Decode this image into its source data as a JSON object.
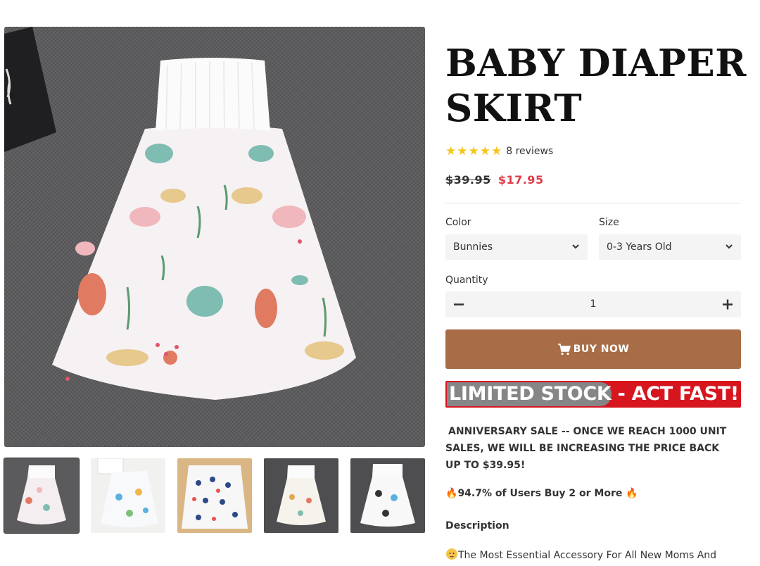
{
  "product": {
    "title": "BABY DIAPER SKIRT",
    "rating": {
      "stars": 5,
      "reviews_label": "8 reviews"
    },
    "price": {
      "compare_at": "$39.95",
      "sale": "$17.95"
    }
  },
  "options": {
    "color": {
      "label": "Color",
      "selected": "Bunnies"
    },
    "size": {
      "label": "Size",
      "selected": "0-3 Years Old"
    }
  },
  "quantity": {
    "label": "Quantity",
    "value": "1"
  },
  "buy_button": {
    "label": "BUY NOW",
    "icon": "cart-icon"
  },
  "stock_banner": {
    "label": "LIMITED STOCK - ACT FAST!"
  },
  "promo": {
    "anniversary": "ANNIVERSARY SALE -- ONCE WE REACH 1000 UNIT SALES, WE WILL BE INCREASING THE PRICE BACK UP TO $39.95!",
    "buy_more": "94.7% of Users Buy 2 or More"
  },
  "description": {
    "heading": "Description",
    "first_line": "The Most Essential Accessory For All New Moms And"
  },
  "gallery": {
    "thumbnail_count": 5,
    "active_index": 0
  },
  "colors": {
    "buy_button": "#a86d47",
    "sale_price": "#e03b47",
    "banner_red": "#d7151f",
    "star": "#f5c518"
  }
}
